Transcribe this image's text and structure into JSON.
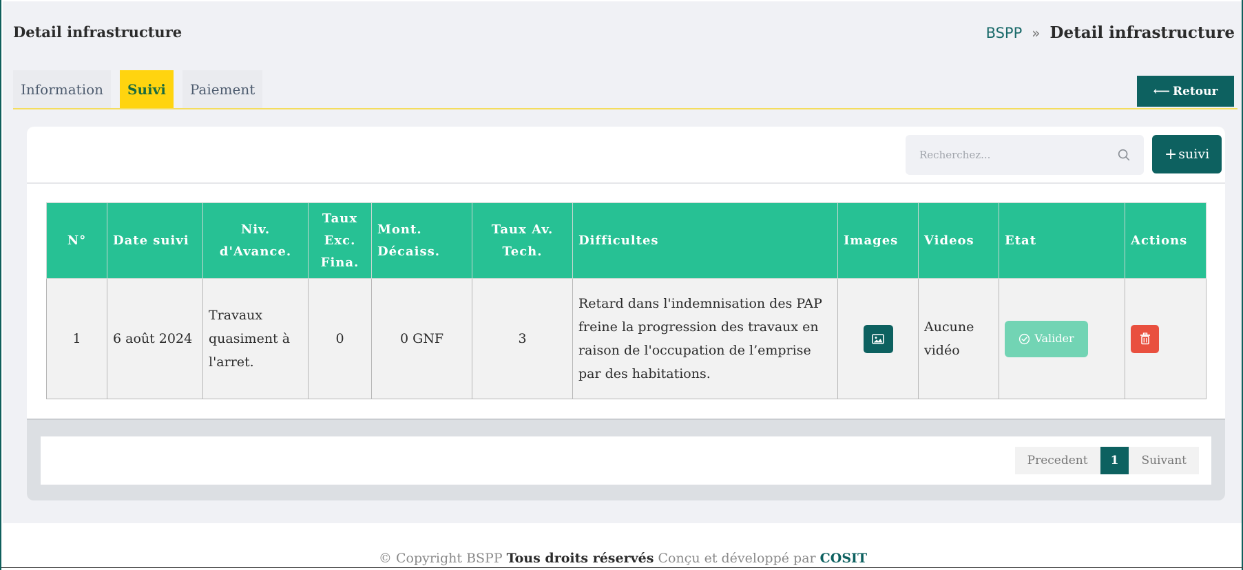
{
  "header": {
    "title": "Detail infrastructure",
    "breadcrumb": {
      "home": "BSPP",
      "separator": "»",
      "current": "Detail infrastructure"
    }
  },
  "tabs": [
    {
      "label": "Information",
      "active": false
    },
    {
      "label": "Suivi",
      "active": true
    },
    {
      "label": "Paiement",
      "active": false
    }
  ],
  "retour": {
    "arrow": "⟵",
    "label": "Retour"
  },
  "toolbar": {
    "search_placeholder": "Recherchez...",
    "search_icon": "search-icon",
    "add_plus": "+",
    "add_label": "suivi"
  },
  "table": {
    "headers": {
      "num": "N°",
      "date": "Date suivi",
      "niv": "Niv. d'Avance.",
      "taux_exc": "Taux Exc. Fina.",
      "mont": "Mont. Décaiss.",
      "taux_av": "Taux Av. Tech.",
      "difficultes": "Difficultes",
      "images": "Images",
      "videos": "Videos",
      "etat": "Etat",
      "actions": "Actions"
    },
    "rows": [
      {
        "num": "1",
        "date": "6 août 2024",
        "niv": "Travaux quasiment à l'arret.",
        "taux_exc": "0",
        "mont": "0 GNF",
        "taux_av": "3",
        "difficultes": "Retard dans l'indemnisation des PAP freine la progression des travaux en raison de l'occupation de l’emprise par des habitations.",
        "images_icon": "image-icon",
        "videos": "Aucune vidéo",
        "etat_label": "Valider",
        "etat_icon": "check-circle-icon",
        "action_icon": "trash-icon"
      }
    ]
  },
  "pagination": {
    "prev": "Precedent",
    "current": "1",
    "next": "Suivant"
  },
  "footer": {
    "prefix": "© Copyright BSPP",
    "rights": "Tous droits réservés",
    "made_by": "Conçu et développé par",
    "brand": "COSIT"
  },
  "colors": {
    "primary": "#0d6160",
    "table_header": "#27c194",
    "active_tab": "#ffd40f",
    "valider": "#72d4b4",
    "delete": "#e9503f",
    "date_red": "#e21b1b"
  }
}
